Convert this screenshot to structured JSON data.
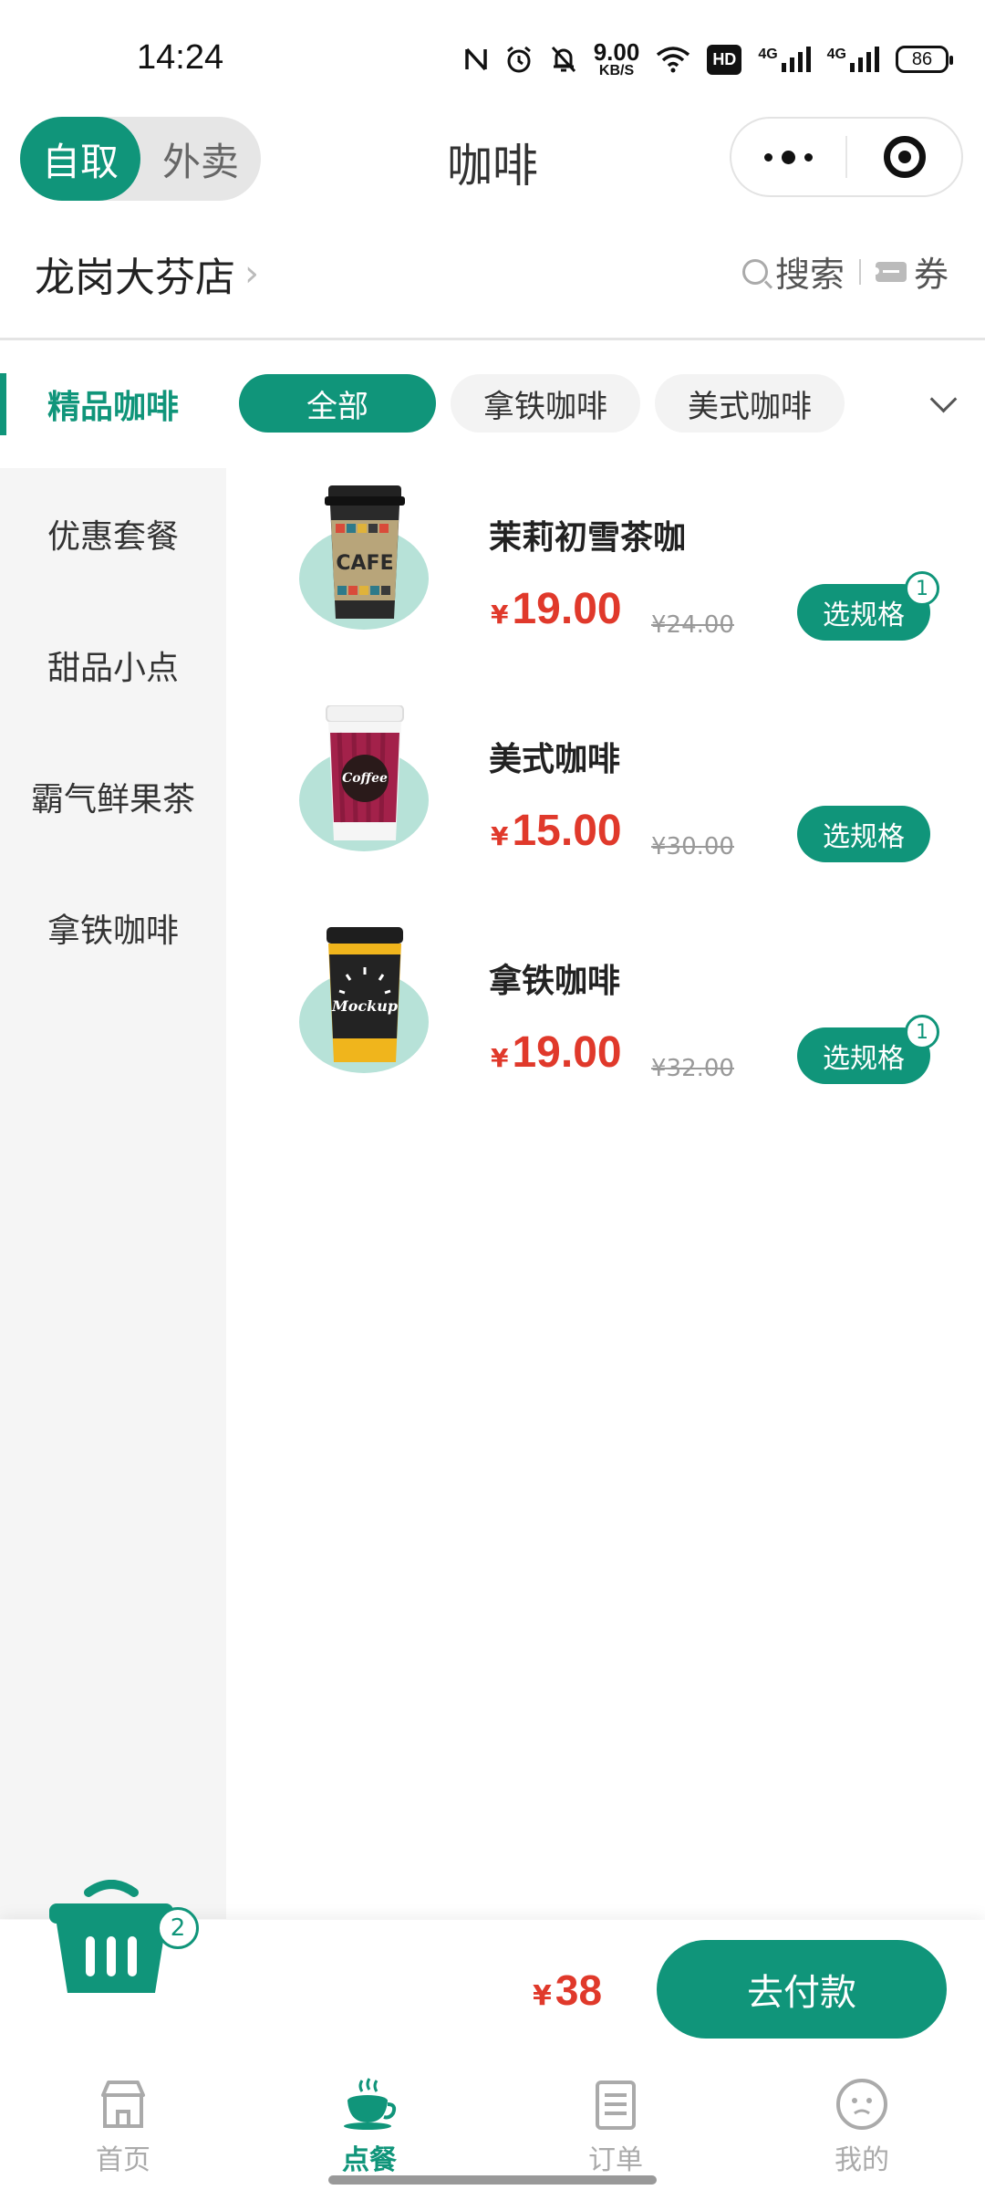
{
  "status_bar": {
    "time": "14:24",
    "net_speed_value": "9.00",
    "net_speed_unit": "KB/S",
    "hd_label": "HD",
    "signal1_label": "4G",
    "signal2_label": "4G",
    "battery": "86"
  },
  "header": {
    "mode_pickup": "自取",
    "mode_delivery": "外卖",
    "title": "咖啡"
  },
  "store": {
    "name": "龙岗大芬店",
    "search_label": "搜索",
    "coupon_label": "券"
  },
  "sidebar": {
    "items": [
      {
        "label": "精品咖啡"
      },
      {
        "label": "优惠套餐"
      },
      {
        "label": "甜品小点"
      },
      {
        "label": "霸气鲜果茶"
      },
      {
        "label": "拿铁咖啡"
      }
    ]
  },
  "chips": [
    "全部",
    "拿铁咖啡",
    "美式咖啡"
  ],
  "products": [
    {
      "name": "茉莉初雪茶咖",
      "currency": "¥",
      "price": "19.00",
      "original_price": "¥24.00",
      "button": "选规格",
      "badge": "1"
    },
    {
      "name": "美式咖啡",
      "currency": "¥",
      "price": "15.00",
      "original_price": "¥30.00",
      "button": "选规格",
      "badge": ""
    },
    {
      "name": "拿铁咖啡",
      "currency": "¥",
      "price": "19.00",
      "original_price": "¥32.00",
      "button": "选规格",
      "badge": "1"
    }
  ],
  "cup_prints": {
    "cafe": "CAFE",
    "coffee": "Coffee",
    "mockup": "Mockup"
  },
  "cart": {
    "count": "2",
    "currency": "¥",
    "total": "38",
    "checkout_label": "去付款"
  },
  "tabbar": {
    "home": "首页",
    "order": "点餐",
    "orders": "订单",
    "me": "我的"
  },
  "colors": {
    "accent": "#10957a",
    "price": "#e0392b"
  }
}
